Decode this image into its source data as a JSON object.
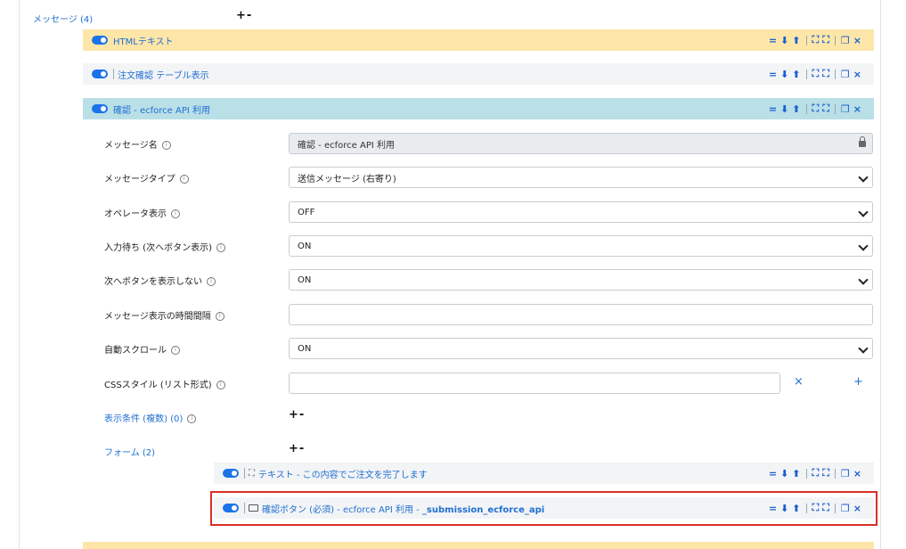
{
  "messages_link": "メッセージ (4)",
  "plus_minus": "+-",
  "bars": {
    "html_text": "HTMLテキスト",
    "order_confirm": "注文確認 テーブル表示",
    "confirm_api": "確認 - ecforce API 利用",
    "text_complete": "テキスト - この内容でご注文を完了します",
    "confirm_button_prefix": "確認ボタン (必須) - ecforce API 利用 - ",
    "confirm_button_suffix": "_submission_ecforce_api"
  },
  "tool_glyphs": {
    "equals": "=",
    "down": "⬇",
    "up": "⬆",
    "collapse": "⛶",
    "expand": "⛶",
    "copy": "❐",
    "close": "×"
  },
  "fields": {
    "message_name": {
      "label": "メッセージ名",
      "value": "確認 - ecforce API 利用"
    },
    "message_type": {
      "label": "メッセージタイプ",
      "value": "送信メッセージ (右寄り)"
    },
    "operator_display": {
      "label": "オペレータ表示",
      "value": "OFF"
    },
    "wait_input": {
      "label": "入力待ち (次へボタン表示)",
      "value": "ON"
    },
    "hide_next": {
      "label": "次へボタンを表示しない",
      "value": "ON"
    },
    "display_interval": {
      "label": "メッセージ表示の時間間隔",
      "value": ""
    },
    "auto_scroll": {
      "label": "自動スクロール",
      "value": "ON"
    },
    "css_style": {
      "label": "CSSスタイル (リスト形式)",
      "value": ""
    }
  },
  "css_clear": "×",
  "css_add": "+",
  "display_conditions_link": "表示条件 (複数) (0)",
  "forms_link": "フォーム (2)",
  "info_glyph": "i",
  "colors": {
    "accent": "#1a73e8",
    "bar_yellow": "#fde6a8",
    "bar_cyan": "#b9dfe7",
    "bar_gray": "#f3f4f6",
    "highlight": "#d93025"
  }
}
